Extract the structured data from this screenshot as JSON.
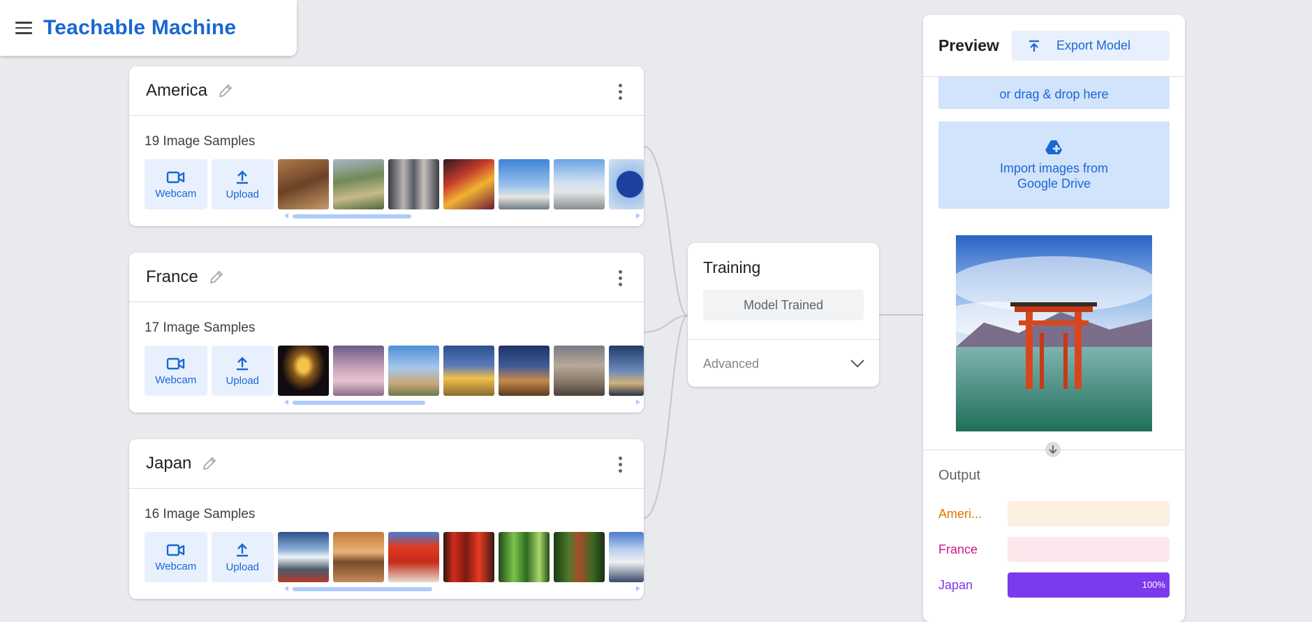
{
  "header": {
    "title": "Teachable Machine"
  },
  "classes": [
    {
      "name": "America",
      "sample_count": "19 Image Samples",
      "webcam_label": "Webcam",
      "upload_label": "Upload"
    },
    {
      "name": "France",
      "sample_count": "17 Image Samples",
      "webcam_label": "Webcam",
      "upload_label": "Upload"
    },
    {
      "name": "Japan",
      "sample_count": "16 Image Samples",
      "webcam_label": "Webcam",
      "upload_label": "Upload"
    }
  ],
  "training": {
    "title": "Training",
    "status_button": "Model Trained",
    "advanced_label": "Advanced"
  },
  "preview": {
    "title": "Preview",
    "export_label": "Export Model",
    "drop_text": "or drag & drop here",
    "drive_line1": "Import images from",
    "drive_line2": "Google Drive",
    "output_title": "Output",
    "outputs": [
      {
        "label": "Ameri...",
        "value": 0,
        "color": "#e37400",
        "track": "#feefe3",
        "fill": "#e37400",
        "pct": ""
      },
      {
        "label": "France",
        "value": 0,
        "color": "#d01884",
        "track": "#fce8ec",
        "fill": "#d01884",
        "pct": ""
      },
      {
        "label": "Japan",
        "value": 1.0,
        "color": "#7b39e6",
        "track": "#ede4fb",
        "fill": "#7c3aed",
        "pct": "100%"
      }
    ]
  },
  "colors": {
    "accent": "#1967d2",
    "accent_light": "#e8f0fe",
    "drop_bg": "#d2e3fc"
  }
}
